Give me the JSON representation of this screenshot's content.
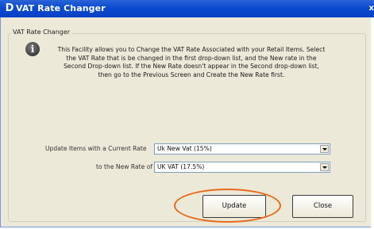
{
  "window": {
    "title": "VAT Rate Changer",
    "app_icon": "D",
    "close_glyph": "x"
  },
  "group": {
    "label": "VAT Rate Changer"
  },
  "info": {
    "icon": "info-icon",
    "message": "This Facility allows you to Change the VAT Rate Associated with your Retail Items. Select the VAT Rate that is be changed in the first drop-down list, and the New rate in the Second Drop-down list. If the New Rate doesn't appear in the Second drop-down list, then go to the Previous Screen and Create the New Rate first."
  },
  "form": {
    "current_rate_label": "Update Items with a Current Rate",
    "current_rate_value": "Uk New Vat (15%)",
    "new_rate_label": "to the New Rate of",
    "new_rate_value": "UK VAT (17.5%)"
  },
  "buttons": {
    "update_label": "Update",
    "close_label": "Close"
  },
  "colors": {
    "titlebar": "#0a4ad0",
    "window_bg": "#ece9d8",
    "annotation": "#e86a1c"
  }
}
